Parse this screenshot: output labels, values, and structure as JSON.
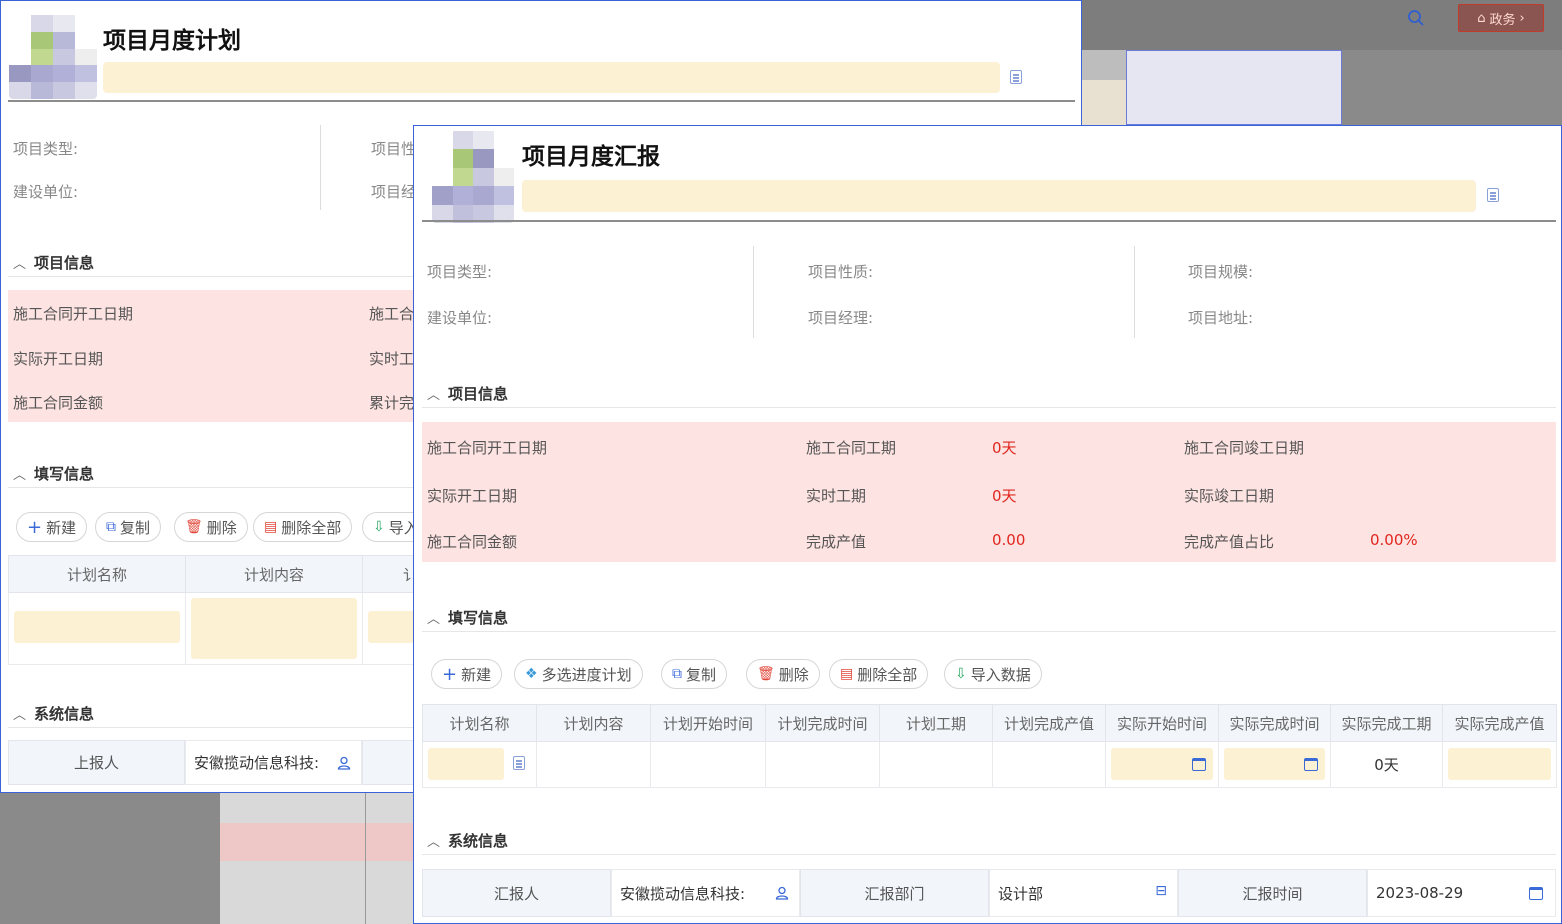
{
  "topbar": {
    "gov_button": "政务",
    "gov_chevron": "›"
  },
  "plan_window": {
    "title": "项目月度计划",
    "basic_labels": [
      "项目类型:",
      "建设单位:",
      "项目性",
      "项目经"
    ],
    "project_info": {
      "heading": "项目信息",
      "rows": [
        "施工合同开工日期",
        "实际开工日期",
        "施工合同金额"
      ],
      "rows_col2": [
        "施工合",
        "实时工",
        "累计完"
      ]
    },
    "fill_info": {
      "heading": "填写信息",
      "buttons": [
        "新建",
        "复制",
        "删除",
        "删除全部",
        "导入"
      ],
      "columns": [
        "计划名称",
        "计划内容",
        "讠"
      ]
    },
    "system_info": {
      "heading": "系统信息",
      "reporter_label": "上报人",
      "reporter_value": "安徽揽动信息科技:"
    }
  },
  "report_window": {
    "title": "项目月度汇报",
    "basic": {
      "col1": [
        "项目类型:",
        "建设单位:"
      ],
      "col2": [
        "项目性质:",
        "项目经理:"
      ],
      "col3": [
        "项目规模:",
        "项目地址:"
      ]
    },
    "project_info": {
      "heading": "项目信息",
      "contract_start": "施工合同开工日期",
      "contract_period": "施工合同工期",
      "contract_period_value": "0天",
      "contract_end": "施工合同竣工日期",
      "actual_start": "实际开工日期",
      "realtime_period": "实时工期",
      "realtime_period_value": "0天",
      "actual_end": "实际竣工日期",
      "contract_amount": "施工合同金额",
      "output_value": "完成产值",
      "output_value_value": "0.00",
      "output_ratio": "完成产值占比",
      "output_ratio_value": "0.00%"
    },
    "fill_info": {
      "heading": "填写信息",
      "buttons": [
        "新建",
        "多选进度计划",
        "复制",
        "删除",
        "删除全部",
        "导入数据"
      ],
      "columns": [
        "计划名称",
        "计划内容",
        "计划开始时间",
        "计划完成时间",
        "计划工期",
        "计划完成产值",
        "实际开始时间",
        "实际完成时间",
        "实际完成工期",
        "实际完成产值"
      ],
      "row": {
        "actual_period": "0天"
      }
    },
    "system_info": {
      "heading": "系统信息",
      "reporter_label": "汇报人",
      "reporter_value": "安徽揽动信息科技:",
      "dept_label": "汇报部门",
      "dept_value": "设计部",
      "time_label": "汇报时间",
      "time_value": "2023-08-29"
    }
  }
}
